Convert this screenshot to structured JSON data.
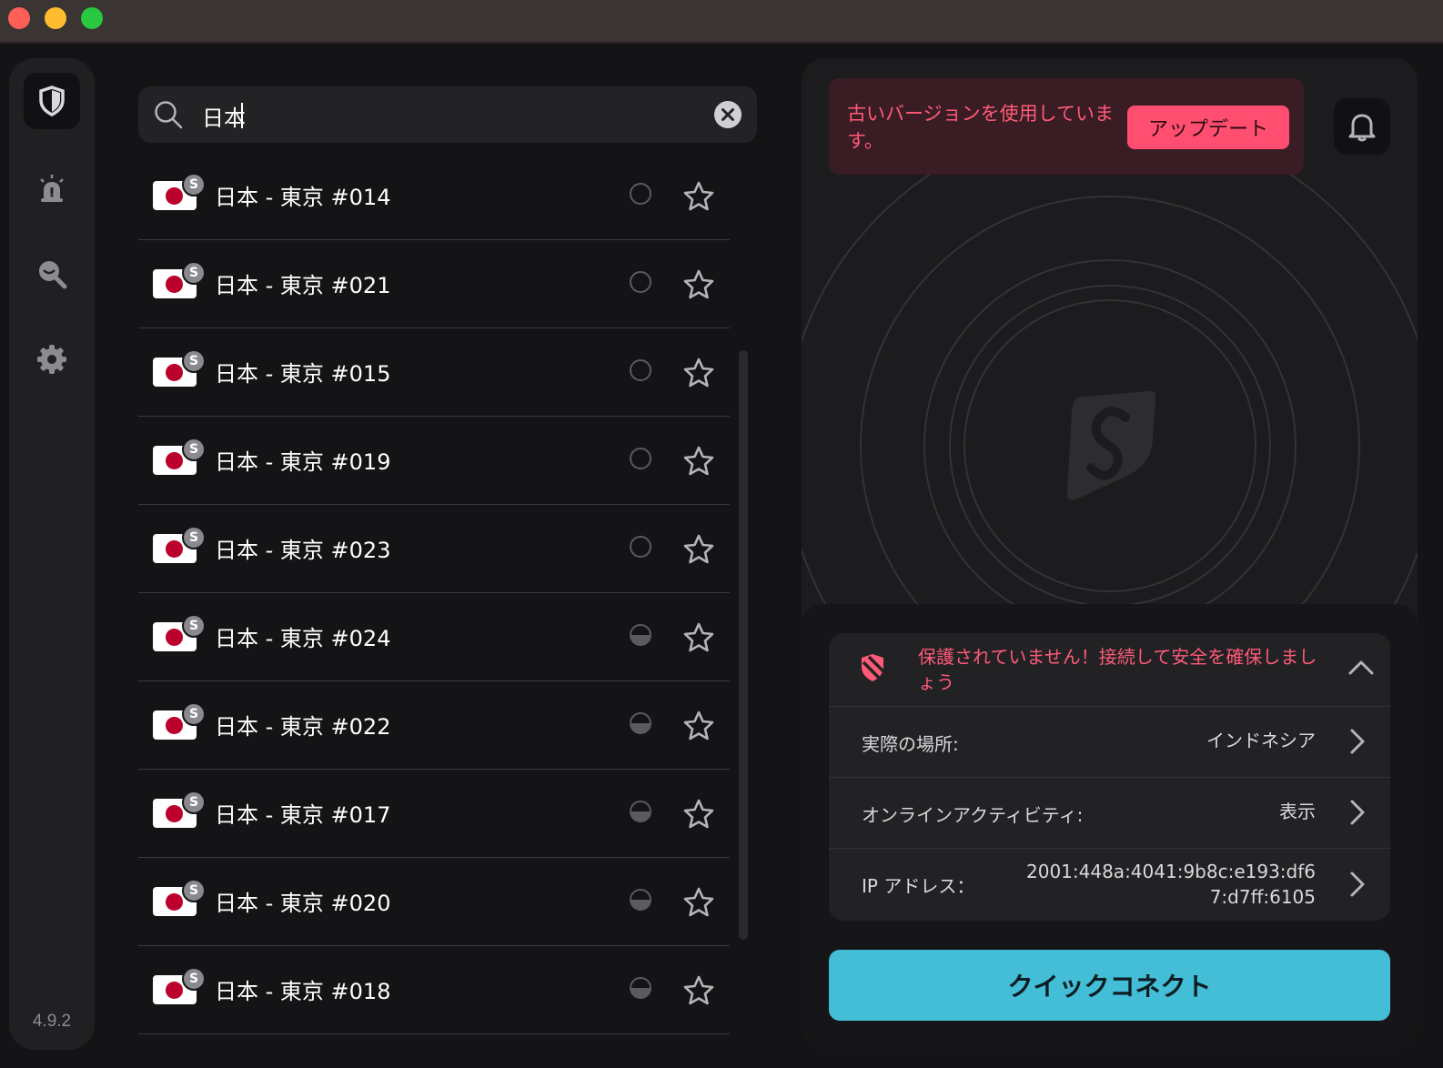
{
  "window": {
    "controls": [
      "close",
      "minimize",
      "zoom"
    ]
  },
  "sidebar": {
    "items": [
      {
        "icon": "shield-icon",
        "active": true
      },
      {
        "icon": "alert-icon",
        "active": false
      },
      {
        "icon": "search-privacy-icon",
        "active": false
      },
      {
        "icon": "gear-icon",
        "active": false
      }
    ],
    "version": "4.9.2"
  },
  "search": {
    "value": "日本",
    "icon": "search-icon",
    "clear_icon": "clear-icon"
  },
  "servers": [
    {
      "label": "日本 - 東京 #014",
      "badge": "S",
      "load": "empty"
    },
    {
      "label": "日本 - 東京 #021",
      "badge": "S",
      "load": "empty"
    },
    {
      "label": "日本 - 東京 #015",
      "badge": "S",
      "load": "empty"
    },
    {
      "label": "日本 - 東京 #019",
      "badge": "S",
      "load": "empty"
    },
    {
      "label": "日本 - 東京 #023",
      "badge": "S",
      "load": "empty"
    },
    {
      "label": "日本 - 東京 #024",
      "badge": "S",
      "load": "half"
    },
    {
      "label": "日本 - 東京 #022",
      "badge": "S",
      "load": "half"
    },
    {
      "label": "日本 - 東京 #017",
      "badge": "S",
      "load": "half"
    },
    {
      "label": "日本 - 東京 #020",
      "badge": "S",
      "load": "half"
    },
    {
      "label": "日本 - 東京 #018",
      "badge": "S",
      "load": "half"
    }
  ],
  "banner": {
    "text": "古いバージョンを使用しています。",
    "button": "アップデート"
  },
  "status": {
    "message": "保護されていません！接続して安全を確保しましょう",
    "rows": [
      {
        "label": "実際の場所:",
        "value": "インドネシア"
      },
      {
        "label": "オンラインアクティビティ:",
        "value": "表示"
      },
      {
        "label": "IP アドレス：",
        "value_line1": "2001:448a:4041:9b8c:e193:df6",
        "value_line2": "7:d7ff:6105"
      }
    ]
  },
  "quick_connect": "クイックコネクト",
  "colors": {
    "accent": "#43bed6",
    "alert": "#ff5a78",
    "update": "#ff4e70"
  }
}
